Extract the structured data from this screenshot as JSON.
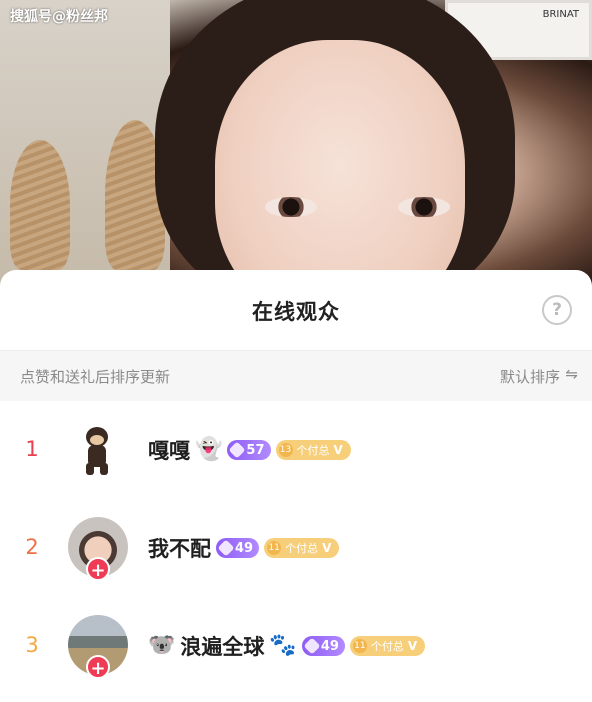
{
  "watermark": "搜狐号@粉丝邦",
  "video": {
    "frame_text": "BRINAT"
  },
  "sheet": {
    "title": "在线观众",
    "help": "?",
    "hint": "点赞和送礼后排序更新",
    "sort_label": "默认排序",
    "sort_icon": "⇋"
  },
  "viewers": [
    {
      "rank": "1",
      "name": "嘎嘎",
      "name_suffix_emoji": "👻",
      "level": "57",
      "fan_level": "13",
      "fan_text": "个付总",
      "fan_check": "V",
      "plus": ""
    },
    {
      "rank": "2",
      "name": "我不配",
      "level": "49",
      "fan_level": "11",
      "fan_text": "个付总",
      "fan_check": "V",
      "plus": "+"
    },
    {
      "rank": "3",
      "name_prefix_emoji": "🐨",
      "name": "浪遍全球",
      "name_suffix_emoji": "🐾",
      "level": "49",
      "fan_level": "11",
      "fan_text": "个付总",
      "fan_check": "V",
      "plus": "+"
    }
  ],
  "colors": {
    "rank1": "#ea3f4f",
    "rank2": "#f07148",
    "rank3": "#f5a742",
    "plus_badge": "#ef3b55",
    "level_badge": "#8e5cf4",
    "fan_badge": "#f7cf7a"
  }
}
